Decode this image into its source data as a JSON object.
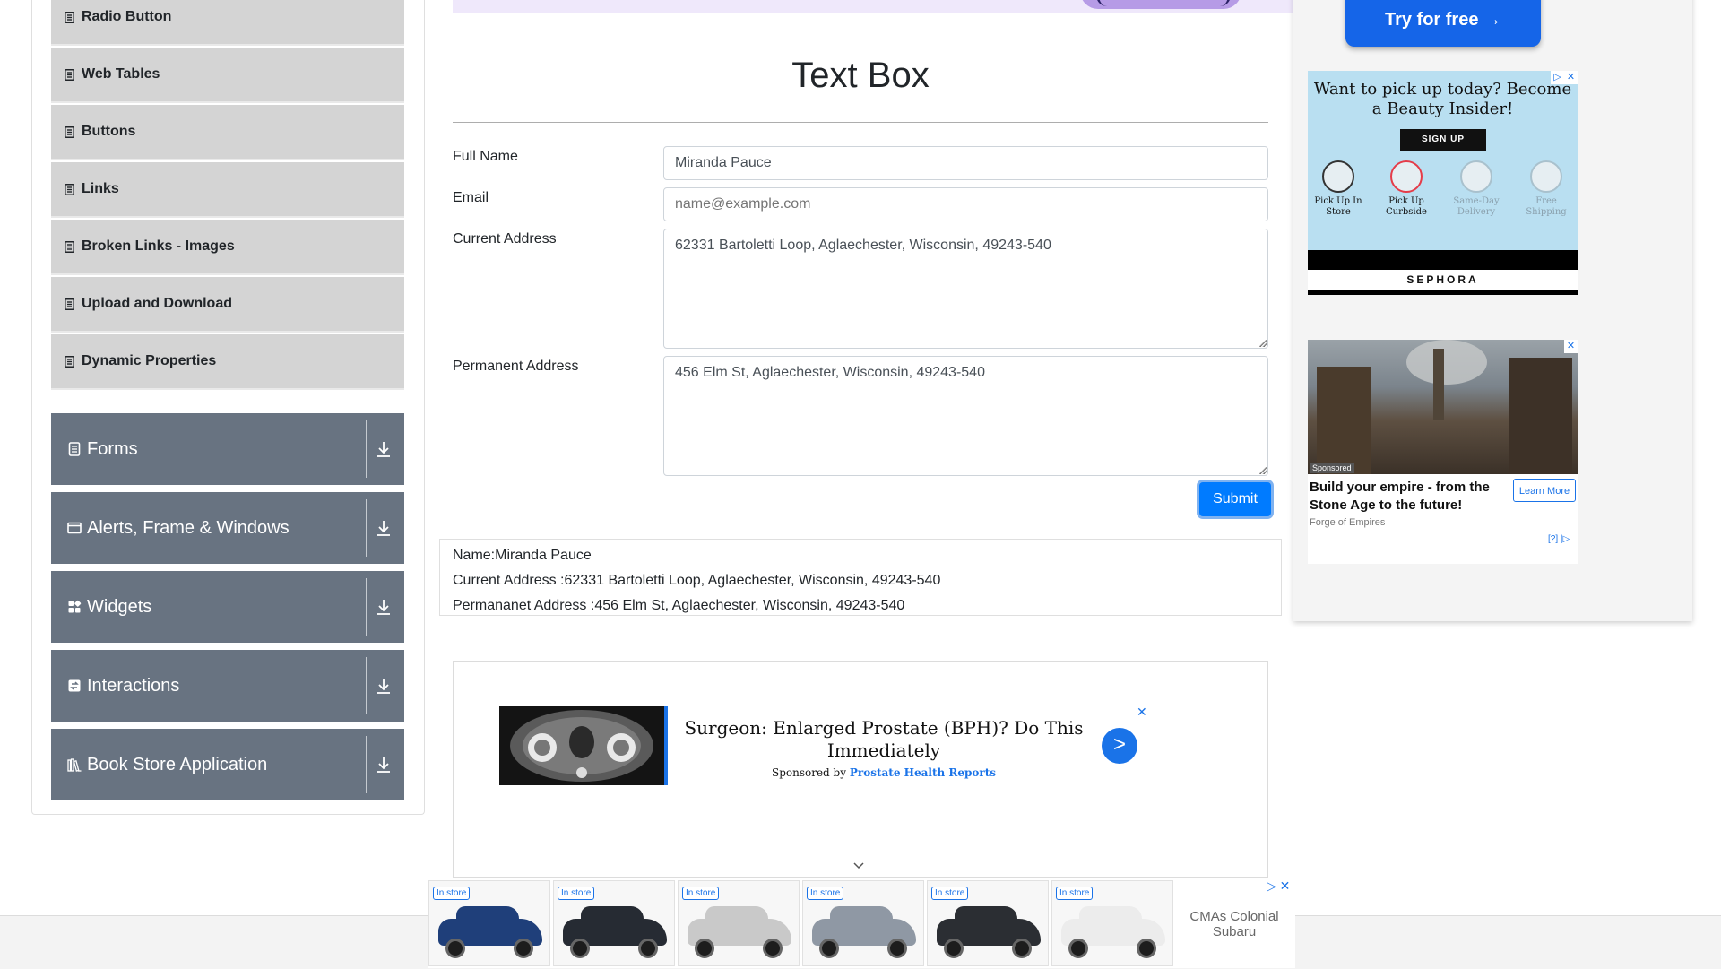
{
  "sidebar": {
    "sub_items": [
      {
        "label": "Radio Button"
      },
      {
        "label": "Web Tables"
      },
      {
        "label": "Buttons"
      },
      {
        "label": "Links"
      },
      {
        "label": "Broken Links - Images"
      },
      {
        "label": "Upload and Download"
      },
      {
        "label": "Dynamic Properties"
      }
    ],
    "groups": [
      {
        "label": "Forms",
        "icon": "document-icon"
      },
      {
        "label": "Alerts, Frame & Windows",
        "icon": "window-icon"
      },
      {
        "label": "Widgets",
        "icon": "grid-icon"
      },
      {
        "label": "Interactions",
        "icon": "interactions-icon"
      },
      {
        "label": "Book Store Application",
        "icon": "books-icon"
      }
    ]
  },
  "main": {
    "title": "Text Box",
    "form": {
      "full_name": {
        "label": "Full Name",
        "value": "Miranda Pauce"
      },
      "email": {
        "label": "Email",
        "value": "",
        "placeholder": "name@example.com"
      },
      "current_address": {
        "label": "Current Address",
        "value": "62331 Bartoletti Loop, Aglaechester, Wisconsin, 49243-540"
      },
      "permanent_address": {
        "label": "Permanent Address",
        "value": "456 Elm St, Aglaechester, Wisconsin, 49243-540"
      },
      "submit_label": "Submit"
    },
    "output": {
      "name_line": "Name:Miranda Pauce",
      "current_line": "Current Address :62331 Bartoletti Loop, Aglaechester, Wisconsin, 49243-540",
      "permanent_line": "Permananet Address :456 Elm St, Aglaechester, Wisconsin, 49243-540"
    }
  },
  "ads": {
    "try_button": "Try for free →",
    "sephora": {
      "headline": "Want to pick up today? Become a Beauty Insider!",
      "signup": "SIGN UP",
      "options": [
        "Pick Up In Store",
        "Pick Up Curbside",
        "Same-Day Delivery",
        "Free Shipping"
      ],
      "brand": "SEPHORA"
    },
    "empire": {
      "tag": "Sponsored",
      "title": "Build your empire - from the Stone Age to the future!",
      "source": "Forge of Empires",
      "cta": "Learn More",
      "info": "[?] |"
    },
    "prostate": {
      "headline": "Surgeon: Enlarged Prostate (BPH)? Do This Immediately",
      "sponsored_prefix": "Sponsored by",
      "sponsor": "Prostate Health Reports",
      "go": ">"
    },
    "cars": {
      "badge": "In store",
      "dealer": "CMAs Colonial Subaru",
      "colors": [
        "#1f3f7a",
        "#262b33",
        "#c9c9c9",
        "#8f98a4",
        "#2b2e33",
        "#ececec"
      ]
    }
  },
  "colors": {
    "accent": "#007bff",
    "group_bg": "#687381",
    "sub_bg": "#d4d4d4"
  }
}
